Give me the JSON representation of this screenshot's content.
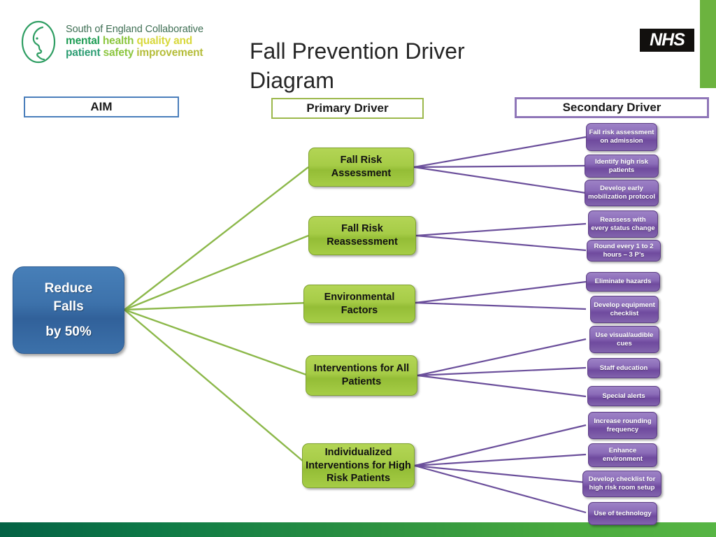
{
  "slide": {
    "title": "Fall Prevention Driver Diagram",
    "title_line1": "Fall Prevention Driver",
    "title_line2": "Diagram"
  },
  "logo": {
    "name": "south-of-england-collaborative-logo",
    "line1": "South of England Collaborative",
    "line2_a": "mental",
    "line2_b": "health",
    "line2_c": "quality",
    "line2_d": "and",
    "line3_a": "patient",
    "line3_b": "safety",
    "line3_c": "improvement",
    "colors": {
      "mark": "#2f9e63",
      "line1": "#3f6f54",
      "mental": "#1f9d55",
      "health": "#8cc63f",
      "quality": "#d8d83c",
      "and": "#d8d83c",
      "patient": "#2e9e74",
      "safety": "#8cc63f",
      "improvement": "#b5bd3a"
    }
  },
  "nhs_logo": {
    "label": "NHS",
    "background": "#12100e",
    "text_color": "#ffffff"
  },
  "decor": {
    "right_bar_color": "#6cb33f",
    "bottom_bar_from": "#046245",
    "bottom_bar_to": "#57b544"
  },
  "headers": [
    {
      "id": "aim",
      "label": "AIM",
      "border_color": "#4a7ebb"
    },
    {
      "id": "primary",
      "label": "Primary Driver",
      "border_color": "#9cb84b"
    },
    {
      "id": "secondary",
      "label": "Secondary Driver",
      "border_color": "#8f76b8"
    }
  ],
  "aim": {
    "line1": "Reduce",
    "line2": "Falls",
    "line3": "by 50%",
    "color": "#3d72ab"
  },
  "primary_drivers": [
    {
      "id": "fall-risk-assessment",
      "label": "Fall Risk Assessment"
    },
    {
      "id": "fall-risk-reassessment",
      "label": "Fall Risk Reassessment"
    },
    {
      "id": "environmental-factors",
      "label": "Environmental Factors"
    },
    {
      "id": "interventions-all-patients",
      "label": "Interventions for All Patients"
    },
    {
      "id": "individualized-interventions",
      "label": "Individualized Interventions for High Risk Patients"
    }
  ],
  "secondary_drivers": [
    {
      "id": "fall-risk-assessment-on-admission",
      "label": "Fall risk assessment on admission",
      "parent": "fall-risk-assessment"
    },
    {
      "id": "identify-high-risk-patients",
      "label": "Identify high risk patients",
      "parent": "fall-risk-assessment"
    },
    {
      "id": "develop-early-mobilization-protocol",
      "label": "Develop early mobilization protocol",
      "parent": "fall-risk-assessment"
    },
    {
      "id": "reassess-with-every-status-change",
      "label": "Reassess with every status change",
      "parent": "fall-risk-reassessment"
    },
    {
      "id": "round-every-1-to-2-hours",
      "label": "Round every 1 to 2 hours – 3 P’s",
      "parent": "fall-risk-reassessment"
    },
    {
      "id": "eliminate-hazards",
      "label": "Eliminate hazards",
      "parent": "environmental-factors"
    },
    {
      "id": "develop-equipment-checklist",
      "label": "Develop equipment checklist",
      "parent": "environmental-factors"
    },
    {
      "id": "use-visual-audible-cues",
      "label": "Use visual/audible cues",
      "parent": "interventions-all-patients"
    },
    {
      "id": "staff-education",
      "label": "Staff education",
      "parent": "interventions-all-patients"
    },
    {
      "id": "special-alerts",
      "label": "Special alerts",
      "parent": "interventions-all-patients"
    },
    {
      "id": "increase-rounding-frequency",
      "label": "Increase rounding frequency",
      "parent": "individualized-interventions"
    },
    {
      "id": "enhance-environment",
      "label": "Enhance environment",
      "parent": "individualized-interventions"
    },
    {
      "id": "develop-checklist-high-risk-room-setup",
      "label": "Develop checklist for high risk room setup",
      "parent": "individualized-interventions"
    },
    {
      "id": "use-of-technology",
      "label": "Use of technology",
      "parent": "individualized-interventions"
    }
  ],
  "connector_colors": {
    "aim_to_primary": "#8cb84a",
    "primary_to_secondary": "#6b4f9b"
  }
}
